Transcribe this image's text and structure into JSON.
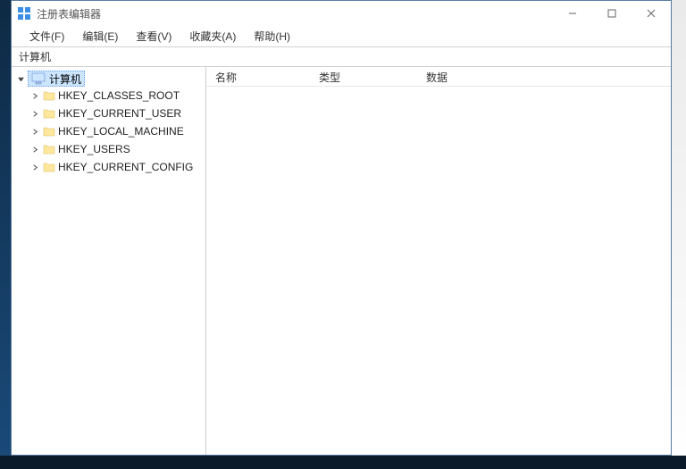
{
  "window": {
    "title": "注册表编辑器"
  },
  "menu": {
    "file": "文件(F)",
    "edit": "编辑(E)",
    "view": "查看(V)",
    "favorites": "收藏夹(A)",
    "help": "帮助(H)"
  },
  "pathbar": {
    "current": "计算机"
  },
  "tree": {
    "root": "计算机",
    "items": [
      {
        "label": "HKEY_CLASSES_ROOT"
      },
      {
        "label": "HKEY_CURRENT_USER"
      },
      {
        "label": "HKEY_LOCAL_MACHINE"
      },
      {
        "label": "HKEY_USERS"
      },
      {
        "label": "HKEY_CURRENT_CONFIG"
      }
    ]
  },
  "columns": {
    "name": "名称",
    "type": "类型",
    "data": "数据"
  }
}
